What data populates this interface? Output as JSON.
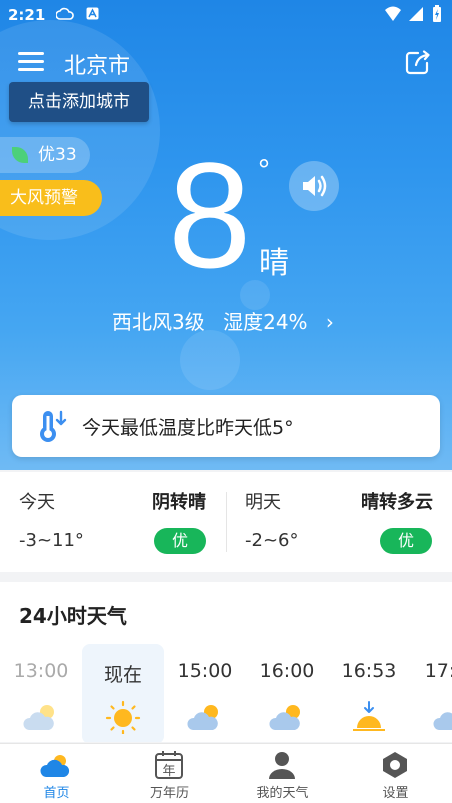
{
  "status_bar": {
    "time": "2:21"
  },
  "header": {
    "city": "北京市"
  },
  "add_city_tip": "点击添加城市",
  "aqi": {
    "label": "优33"
  },
  "warning": {
    "label": "大风预警"
  },
  "current": {
    "temperature": "8",
    "degree_symbol": "°",
    "condition": "晴",
    "wind": "西北风3级",
    "humidity": "湿度24%",
    "chevron": "›"
  },
  "notice": {
    "text": "今天最低温度比昨天低5°"
  },
  "forecast": {
    "today": {
      "day": "今天",
      "condition": "阴转晴",
      "range": "-3~11°",
      "aqi": "优"
    },
    "tomorrow": {
      "day": "明天",
      "condition": "晴转多云",
      "range": "-2~6°",
      "aqi": "优"
    }
  },
  "hourly": {
    "title": "24小时天气",
    "items": [
      {
        "time": "13:00",
        "icon": "partly-cloudy-icon",
        "state": "past"
      },
      {
        "time": "现在",
        "icon": "sun-icon",
        "state": "now"
      },
      {
        "time": "15:00",
        "icon": "partly-cloudy-icon",
        "state": "future"
      },
      {
        "time": "16:00",
        "icon": "partly-cloudy-icon",
        "state": "future"
      },
      {
        "time": "16:53",
        "icon": "sunset-icon",
        "state": "future"
      },
      {
        "time": "17:",
        "icon": "cloud-icon",
        "state": "future"
      }
    ]
  },
  "tabs": [
    {
      "label": "首页",
      "icon": "weather-home-icon",
      "active": true
    },
    {
      "label": "万年历",
      "icon": "calendar-icon",
      "active": false,
      "icon_text": "年"
    },
    {
      "label": "我的天气",
      "icon": "user-icon",
      "active": false
    },
    {
      "label": "设置",
      "icon": "settings-icon",
      "active": false
    }
  ],
  "colors": {
    "primary": "#1f86e6",
    "warning": "#f9be1b",
    "aqi_good": "#18b65a",
    "tip_bg": "#1f4f86"
  }
}
